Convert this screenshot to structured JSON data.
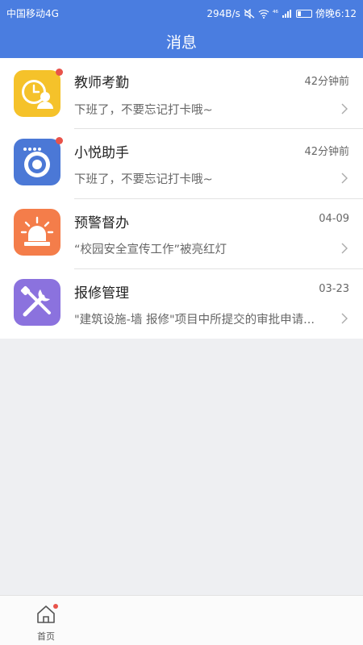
{
  "status_bar": {
    "carrier": "中国移动4G",
    "speed": "294B/s",
    "signal": "⁴⁶",
    "time": "傍晚6:12",
    "icons": [
      "mute-icon",
      "wifi-icon",
      "signal-icon",
      "battery-icon"
    ]
  },
  "header": {
    "title": "消息"
  },
  "messages": [
    {
      "name": "教师考勤",
      "time": "42分钟前",
      "preview": "下班了，不要忘记打卡哦~",
      "icon": "clock-person-icon",
      "color": "#f5c22a",
      "unread": true
    },
    {
      "name": "小悦助手",
      "time": "42分钟前",
      "preview": "下班了，不要忘记打卡哦~",
      "icon": "camera-robot-icon",
      "color": "#4b78d6",
      "unread": true
    },
    {
      "name": "预警督办",
      "time": "04-09",
      "preview": "“校园安全宣传工作”被亮红灯",
      "icon": "alarm-light-icon",
      "color": "#f47d4a",
      "unread": false
    },
    {
      "name": "报修管理",
      "time": "03-23",
      "preview": "\"建筑设施-墙 报修\"项目中所提交的审批申请...",
      "icon": "tools-icon",
      "color": "#8b72de",
      "unread": false
    }
  ],
  "tabbar": {
    "home_label": "首页",
    "home_unread": true
  },
  "colors": {
    "header": "#4a7de0",
    "background": "#eeeff2",
    "badge": "#e8534a"
  }
}
